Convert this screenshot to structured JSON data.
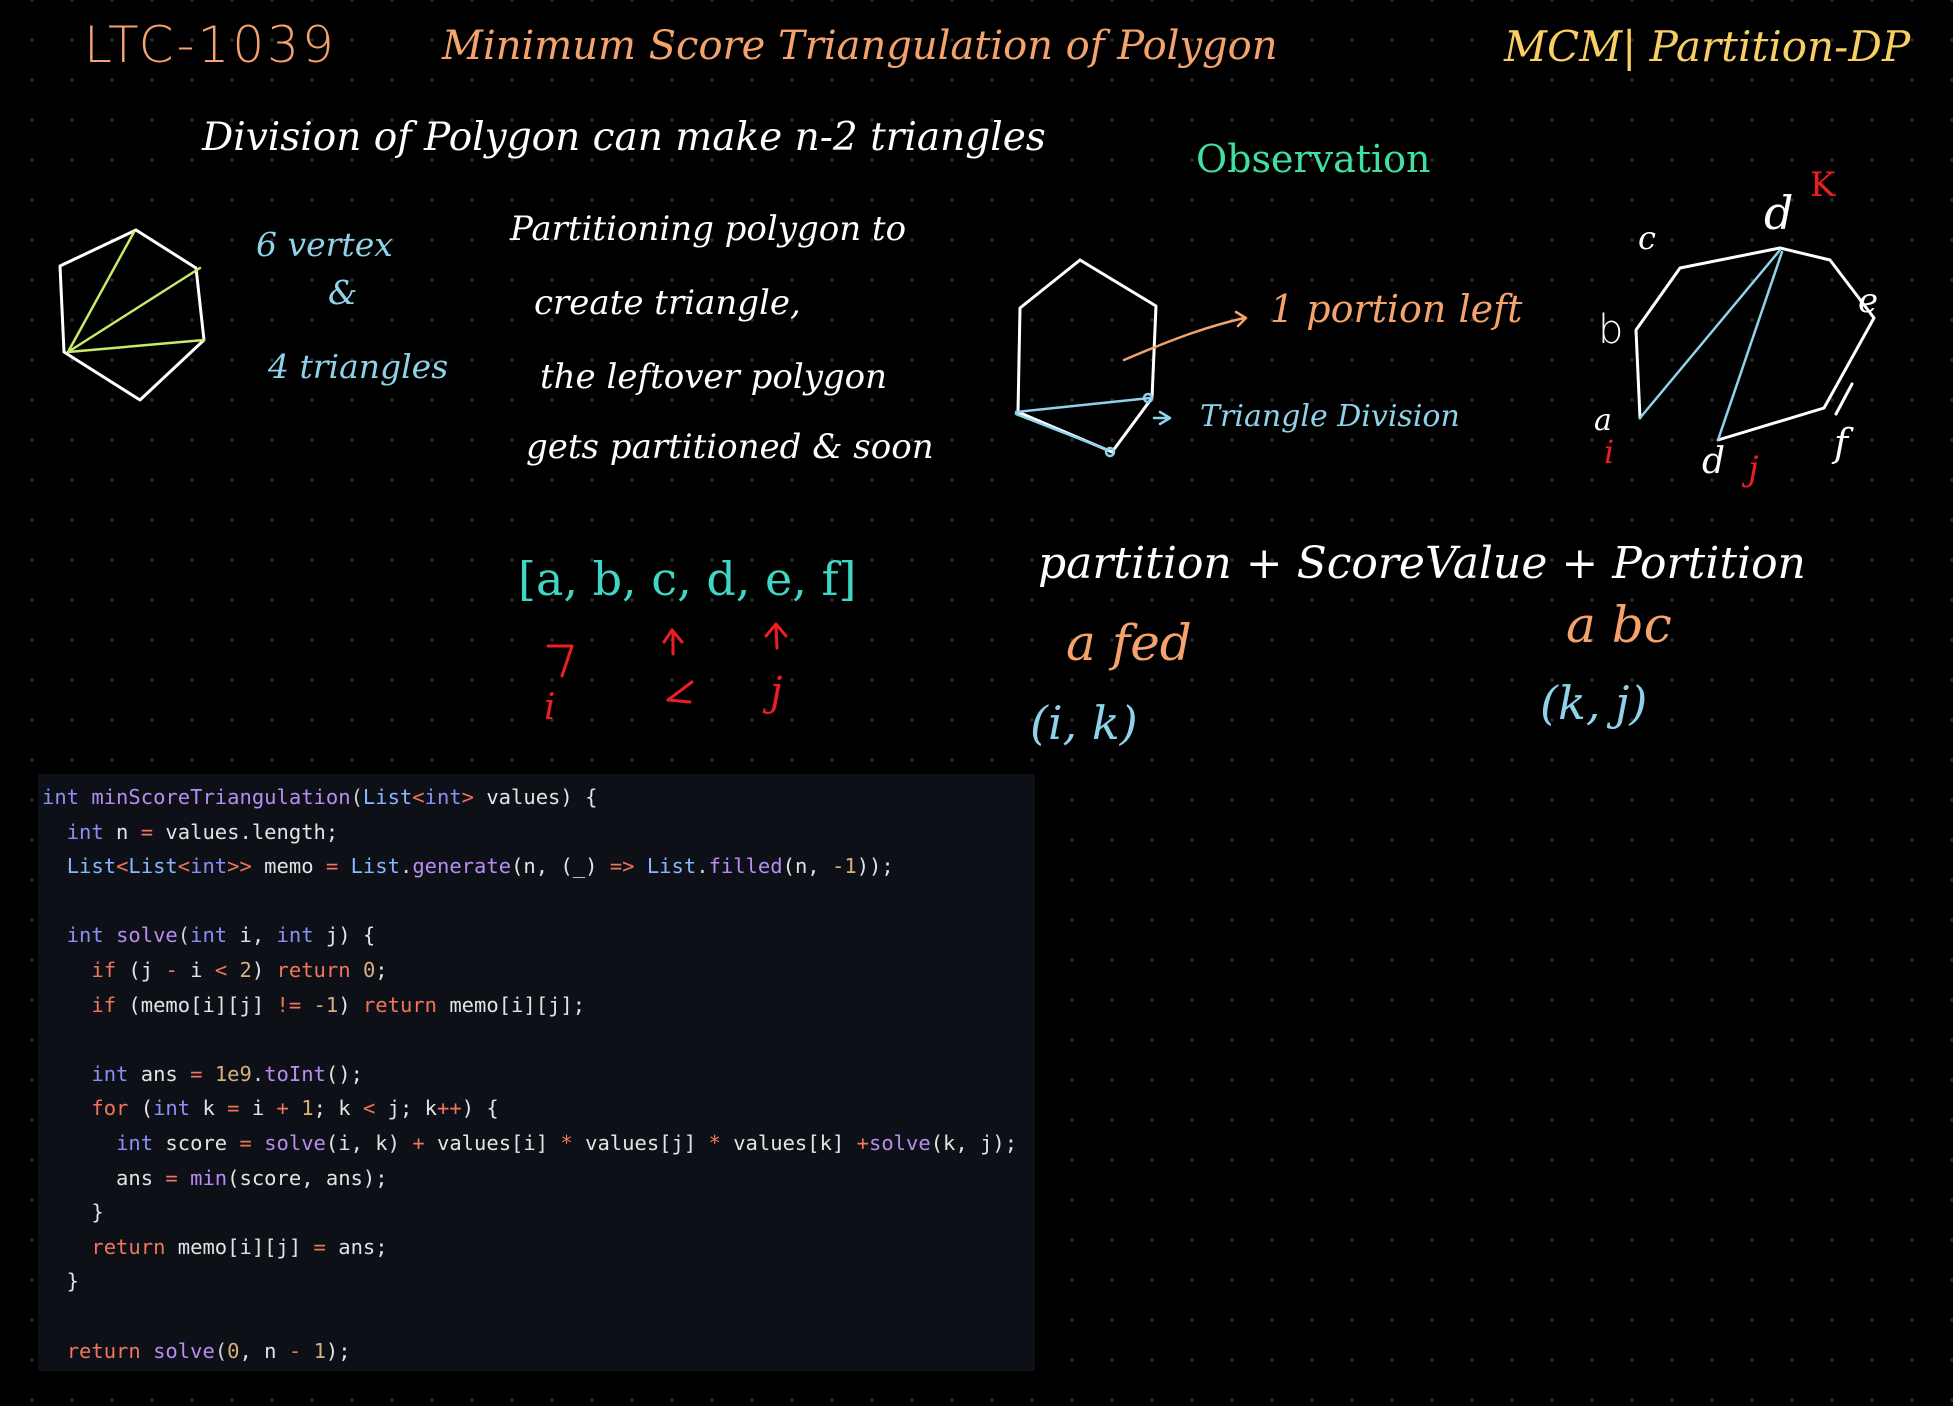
{
  "title_bar": {
    "problem_id": "LTC-1039",
    "problem_title": "Minimum Score Triangulation of Polygon",
    "category": "MCM| Partition-DP"
  },
  "notes": {
    "division_line": "Division of Polygon can make n-2 triangles",
    "vertex_note": [
      "6 vertex",
      "&",
      "4 triangles"
    ],
    "partition_note": [
      "Partitioning polygon to",
      "create triangle,",
      "the leftover polygon",
      "gets partitioned & soon"
    ],
    "array": "[a, b, c, d, e, f]",
    "array_markers": [
      "i",
      "k",
      "j"
    ],
    "observation": "Observation",
    "portion_left": "1 portion left",
    "triangle_division": "Triangle Division",
    "hexagon_labels": {
      "a": "a",
      "b": "b",
      "c": "c",
      "d_top": "d",
      "k": "K",
      "e": "e",
      "f": "f",
      "d_bottom": "d",
      "i": "i",
      "j": "j"
    },
    "formula": "partition + ScoreValue + Portition",
    "left_part": "a fed",
    "left_range": "(i, k)",
    "right_part": "a bc",
    "right_range": "(k, j)"
  },
  "colors": {
    "background": "#000000",
    "title_orange": "#f4a36c",
    "category_yellow": "#f7cf62",
    "ink_white": "#ffffff",
    "ink_blue": "#8fd3ea",
    "ink_green": "#3fe0a0",
    "ink_teal": "#3fd6c4",
    "ink_red": "#ee1d24",
    "ink_lime": "#c6ea6b",
    "code_bg": "#0d1117"
  },
  "code": [
    [
      {
        "t": "int",
        "c": "kw"
      },
      {
        "t": " ",
        "c": "p"
      },
      {
        "t": "minScoreTriangulation",
        "c": "fn"
      },
      {
        "t": "(",
        "c": "p"
      },
      {
        "t": "List",
        "c": "ty"
      },
      {
        "t": "<",
        "c": "op"
      },
      {
        "t": "int",
        "c": "kw"
      },
      {
        "t": ">",
        "c": "op"
      },
      {
        "t": " values) {",
        "c": "id"
      }
    ],
    [
      {
        "t": "  ",
        "c": "p"
      },
      {
        "t": "int",
        "c": "kw"
      },
      {
        "t": " n ",
        "c": "id"
      },
      {
        "t": "=",
        "c": "op"
      },
      {
        "t": " values.length;",
        "c": "id"
      }
    ],
    [
      {
        "t": "  ",
        "c": "p"
      },
      {
        "t": "List",
        "c": "ty"
      },
      {
        "t": "<",
        "c": "op"
      },
      {
        "t": "List",
        "c": "ty"
      },
      {
        "t": "<",
        "c": "op"
      },
      {
        "t": "int",
        "c": "kw"
      },
      {
        "t": ">>",
        "c": "op"
      },
      {
        "t": " memo ",
        "c": "id"
      },
      {
        "t": "=",
        "c": "op"
      },
      {
        "t": " ",
        "c": "p"
      },
      {
        "t": "List",
        "c": "ty"
      },
      {
        "t": ".",
        "c": "p"
      },
      {
        "t": "generate",
        "c": "fn"
      },
      {
        "t": "(n, (_) ",
        "c": "id"
      },
      {
        "t": "=>",
        "c": "op"
      },
      {
        "t": " ",
        "c": "p"
      },
      {
        "t": "List",
        "c": "ty"
      },
      {
        "t": ".",
        "c": "p"
      },
      {
        "t": "filled",
        "c": "fn"
      },
      {
        "t": "(n, ",
        "c": "id"
      },
      {
        "t": "-1",
        "c": "num"
      },
      {
        "t": "));",
        "c": "id"
      }
    ],
    [],
    [
      {
        "t": "  ",
        "c": "p"
      },
      {
        "t": "int",
        "c": "kw"
      },
      {
        "t": " ",
        "c": "p"
      },
      {
        "t": "solve",
        "c": "fn"
      },
      {
        "t": "(",
        "c": "p"
      },
      {
        "t": "int",
        "c": "kw"
      },
      {
        "t": " i, ",
        "c": "id"
      },
      {
        "t": "int",
        "c": "kw"
      },
      {
        "t": " j) {",
        "c": "id"
      }
    ],
    [
      {
        "t": "    ",
        "c": "p"
      },
      {
        "t": "if",
        "c": "ctl"
      },
      {
        "t": " (j ",
        "c": "id"
      },
      {
        "t": "-",
        "c": "op"
      },
      {
        "t": " i ",
        "c": "id"
      },
      {
        "t": "<",
        "c": "op"
      },
      {
        "t": " ",
        "c": "p"
      },
      {
        "t": "2",
        "c": "num"
      },
      {
        "t": ") ",
        "c": "id"
      },
      {
        "t": "return",
        "c": "ctl"
      },
      {
        "t": " ",
        "c": "p"
      },
      {
        "t": "0",
        "c": "num"
      },
      {
        "t": ";",
        "c": "id"
      }
    ],
    [
      {
        "t": "    ",
        "c": "p"
      },
      {
        "t": "if",
        "c": "ctl"
      },
      {
        "t": " (memo[i][j] ",
        "c": "id"
      },
      {
        "t": "!=",
        "c": "op"
      },
      {
        "t": " ",
        "c": "p"
      },
      {
        "t": "-1",
        "c": "num"
      },
      {
        "t": ") ",
        "c": "id"
      },
      {
        "t": "return",
        "c": "ctl"
      },
      {
        "t": " memo[i][j];",
        "c": "id"
      }
    ],
    [],
    [
      {
        "t": "    ",
        "c": "p"
      },
      {
        "t": "int",
        "c": "kw"
      },
      {
        "t": " ans ",
        "c": "id"
      },
      {
        "t": "=",
        "c": "op"
      },
      {
        "t": " ",
        "c": "p"
      },
      {
        "t": "1e9",
        "c": "num"
      },
      {
        "t": ".",
        "c": "p"
      },
      {
        "t": "toInt",
        "c": "fn"
      },
      {
        "t": "();",
        "c": "id"
      }
    ],
    [
      {
        "t": "    ",
        "c": "p"
      },
      {
        "t": "for",
        "c": "ctl"
      },
      {
        "t": " (",
        "c": "id"
      },
      {
        "t": "int",
        "c": "kw"
      },
      {
        "t": " k ",
        "c": "id"
      },
      {
        "t": "=",
        "c": "op"
      },
      {
        "t": " i ",
        "c": "id"
      },
      {
        "t": "+",
        "c": "op"
      },
      {
        "t": " ",
        "c": "p"
      },
      {
        "t": "1",
        "c": "num"
      },
      {
        "t": "; k ",
        "c": "id"
      },
      {
        "t": "<",
        "c": "op"
      },
      {
        "t": " j; k",
        "c": "id"
      },
      {
        "t": "++",
        "c": "op"
      },
      {
        "t": ") {",
        "c": "id"
      }
    ],
    [
      {
        "t": "      ",
        "c": "p"
      },
      {
        "t": "int",
        "c": "kw"
      },
      {
        "t": " score ",
        "c": "id"
      },
      {
        "t": "=",
        "c": "op"
      },
      {
        "t": " ",
        "c": "p"
      },
      {
        "t": "solve",
        "c": "fn"
      },
      {
        "t": "(i, k) ",
        "c": "id"
      },
      {
        "t": "+",
        "c": "op"
      },
      {
        "t": " values[i] ",
        "c": "id"
      },
      {
        "t": "*",
        "c": "op"
      },
      {
        "t": " values[j] ",
        "c": "id"
      },
      {
        "t": "*",
        "c": "op"
      },
      {
        "t": " values[k] ",
        "c": "id"
      },
      {
        "t": "+",
        "c": "op"
      },
      {
        "t": "solve",
        "c": "fn"
      },
      {
        "t": "(k, j);",
        "c": "id"
      }
    ],
    [
      {
        "t": "      ans ",
        "c": "id"
      },
      {
        "t": "=",
        "c": "op"
      },
      {
        "t": " ",
        "c": "p"
      },
      {
        "t": "min",
        "c": "fn"
      },
      {
        "t": "(score, ans);",
        "c": "id"
      }
    ],
    [
      {
        "t": "    }",
        "c": "id"
      }
    ],
    [
      {
        "t": "    ",
        "c": "p"
      },
      {
        "t": "return",
        "c": "ctl"
      },
      {
        "t": " memo[i][j] ",
        "c": "id"
      },
      {
        "t": "=",
        "c": "op"
      },
      {
        "t": " ans;",
        "c": "id"
      }
    ],
    [
      {
        "t": "  }",
        "c": "id"
      }
    ],
    [],
    [
      {
        "t": "  ",
        "c": "p"
      },
      {
        "t": "return",
        "c": "ctl"
      },
      {
        "t": " ",
        "c": "p"
      },
      {
        "t": "solve",
        "c": "fn"
      },
      {
        "t": "(",
        "c": "p"
      },
      {
        "t": "0",
        "c": "num"
      },
      {
        "t": ", n ",
        "c": "id"
      },
      {
        "t": "-",
        "c": "op"
      },
      {
        "t": " ",
        "c": "p"
      },
      {
        "t": "1",
        "c": "num"
      },
      {
        "t": ");",
        "c": "id"
      }
    ]
  ]
}
